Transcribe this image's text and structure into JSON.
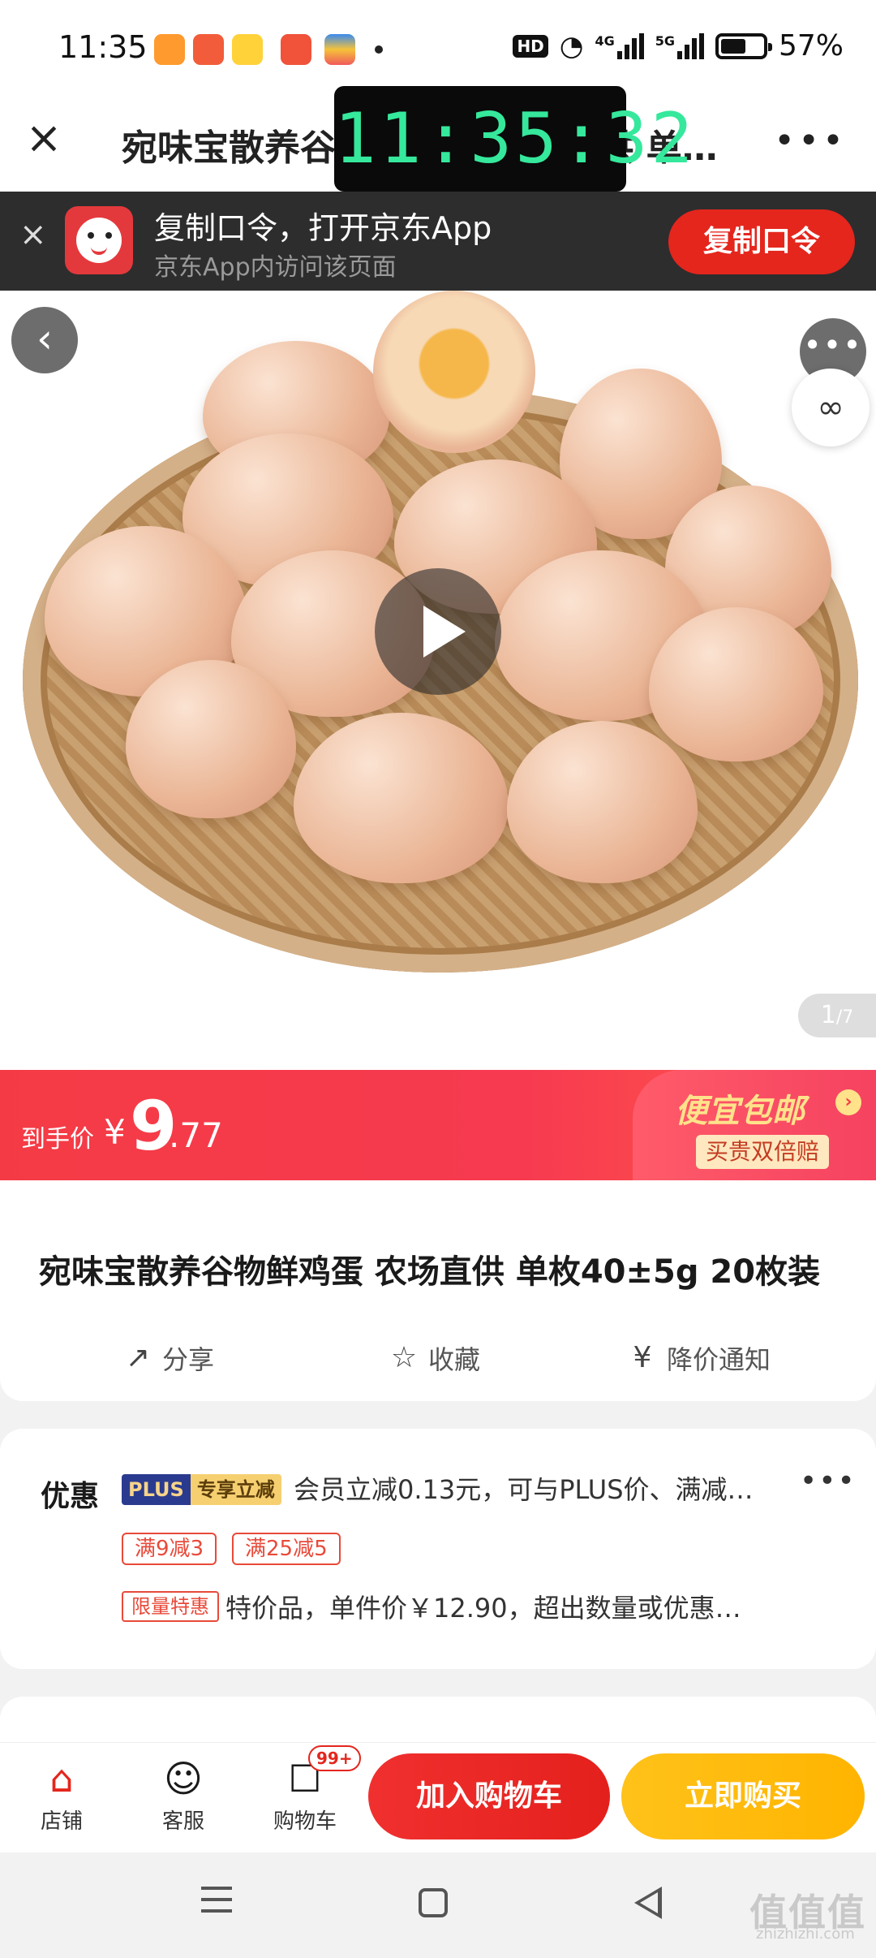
{
  "status_bar": {
    "time": "11:35",
    "network_hd": "HD",
    "network_4g": "4G",
    "network_5g": "5G",
    "battery": "57%"
  },
  "title_bar": {
    "title": "宛味宝散养谷物鲜鸡蛋 农场直供 单…",
    "more": "•••"
  },
  "clock_overlay": "11:35:32",
  "jd_banner": {
    "title": "复制口令，打开京东App",
    "subtitle": "京东App内访问该页面",
    "button": "复制口令"
  },
  "gallery": {
    "page": "1",
    "total": "/7"
  },
  "price": {
    "label": "到手价",
    "currency": "¥",
    "integer": "9",
    "decimal": ".77",
    "promo_title": "便宜包邮",
    "promo_tag": "买贵双倍赔"
  },
  "product": {
    "title": "宛味宝散养谷物鲜鸡蛋 农场直供 单枚40±5g 20枚装",
    "actions": [
      "分享",
      "收藏",
      "降价通知"
    ]
  },
  "offers": {
    "label": "优惠",
    "plus_a": "PLUS",
    "plus_b": "专享立减",
    "line1": "会员立减0.13元，可与PLUS价、满减…",
    "coupons": [
      "满9减3",
      "满25减5"
    ],
    "limited_tag": "限量特惠",
    "line3": "特价品，单件价￥12.90，超出数量或优惠…"
  },
  "bottom_bar": {
    "shop": "店铺",
    "service": "客服",
    "cart": "购物车",
    "cart_badge": "99+",
    "add_cart": "加入购物车",
    "buy_now": "立即购买"
  },
  "watermark": {
    "logo": "值值值",
    "url": "zhizhizhi.com"
  },
  "colors": {
    "jd_red": "#e4261d",
    "price_red": "#f43b45",
    "buy_yellow": "#ffb400",
    "clock_green": "#35e89c"
  }
}
